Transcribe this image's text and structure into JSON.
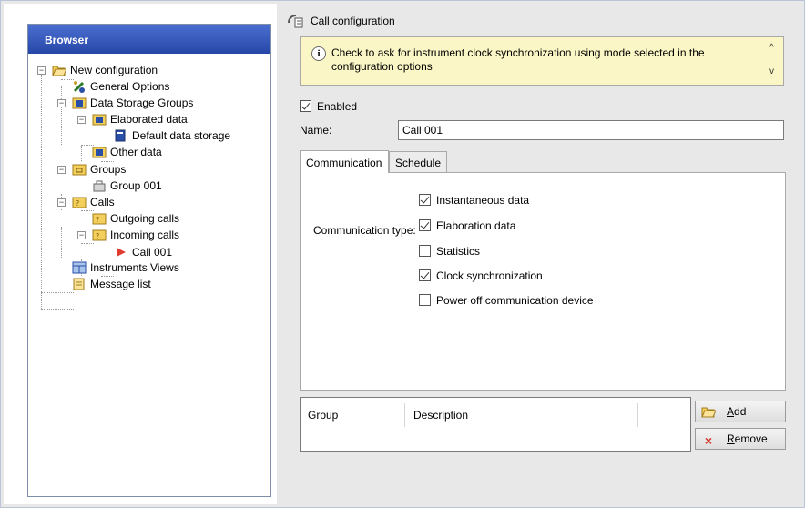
{
  "browser": {
    "title": "Browser",
    "tree": {
      "new_configuration": "New configuration",
      "general_options": "General Options",
      "data_storage_groups": "Data Storage Groups",
      "elaborated_data": "Elaborated data",
      "default_data_storage": "Default data storage",
      "other_data": "Other data",
      "groups": "Groups",
      "group_001": "Group 001",
      "calls": "Calls",
      "outgoing_calls": "Outgoing calls",
      "incoming_calls": "Incoming calls",
      "call_001": "Call 001",
      "instruments_views": "Instruments Views",
      "message_list": "Message list"
    }
  },
  "panel": {
    "title": "Call configuration",
    "hint": "Check to ask for instrument clock synchronization using mode selected in the configuration options",
    "enabled_label": "Enabled",
    "enabled_checked": true,
    "name_label": "Name:",
    "name_value": "Call 001",
    "tabs": [
      {
        "label": "Communication",
        "active": true
      },
      {
        "label": "Schedule",
        "active": false
      }
    ],
    "communication_type_label": "Communication type:",
    "options": [
      {
        "label": "Instantaneous data",
        "checked": true
      },
      {
        "label": "Elaboration data",
        "checked": true
      },
      {
        "label": "Statistics",
        "checked": false
      },
      {
        "label": "Clock synchronization",
        "checked": true
      },
      {
        "label": "Power off communication device",
        "checked": false
      }
    ],
    "grid_headers": [
      "Group",
      "Description"
    ],
    "add_button": {
      "underline": "A",
      "rest": "dd"
    },
    "remove_button": {
      "underline": "R",
      "rest": "emove"
    }
  },
  "colors": {
    "header_gradient_top": "#4a6fd0",
    "header_gradient_bottom": "#2747a8",
    "hint_background": "#fbf6c5",
    "call_icon": "#e03b2f",
    "folder_yellow": "#f3cf5c"
  }
}
